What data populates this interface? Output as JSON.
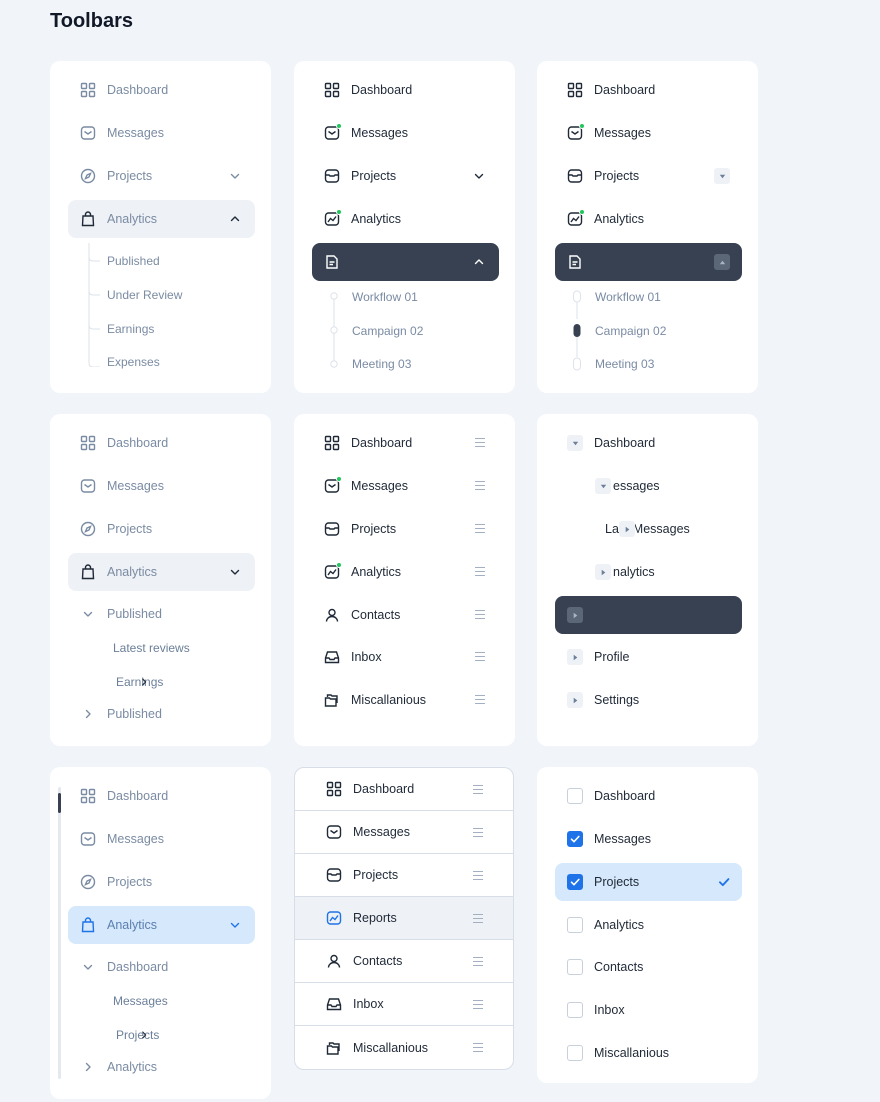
{
  "page": {
    "title": "Toolbars"
  },
  "colors": {
    "accent": "#1e73e8",
    "dark_selected": "#374151",
    "muted_text": "#7a8ba3",
    "badge_dot": "#22c55e"
  },
  "c1": {
    "items": [
      "Dashboard",
      "Messages",
      "Projects",
      "Analytics"
    ],
    "subs": [
      "Published",
      "Under Review",
      "Earnings",
      "Expenses"
    ]
  },
  "c2": {
    "items": [
      "Dashboard",
      "Messages",
      "Projects",
      "Analytics"
    ],
    "subs": [
      "Workflow 01",
      "Campaign 02",
      "Meeting 03"
    ]
  },
  "c3": {
    "items": [
      "Dashboard",
      "Messages",
      "Projects",
      "Analytics"
    ],
    "subs": [
      "Workflow 01",
      "Campaign 02",
      "Meeting 03"
    ]
  },
  "c4": {
    "items": [
      "Dashboard",
      "Messages",
      "Projects",
      "Analytics"
    ],
    "subs": [
      "Published",
      "Latest reviews",
      "Earnings",
      "Published"
    ]
  },
  "c5": {
    "items": [
      "Dashboard",
      "Messages",
      "Projects",
      "Analytics",
      "Contacts",
      "Inbox",
      "Miscallanious"
    ]
  },
  "c6": {
    "items": [
      "Dashboard",
      "essages",
      "Lat : Messages",
      "nalytics",
      "Profile",
      "Settings"
    ]
  },
  "c7": {
    "items": [
      "Dashboard",
      "Messages",
      "Projects",
      "Analytics"
    ],
    "subs": [
      "Dashboard",
      "Messages",
      "Projects",
      "Analytics"
    ]
  },
  "c8": {
    "items": [
      "Dashboard",
      "Messages",
      "Projects",
      "Reports",
      "Contacts",
      "Inbox",
      "Miscallanious"
    ]
  },
  "c9": {
    "items": [
      "Dashboard",
      "Messages",
      "Projects",
      "Analytics",
      "Contacts",
      "Inbox",
      "Miscallanious"
    ],
    "checked": [
      false,
      true,
      true,
      false,
      false,
      false,
      false
    ]
  }
}
